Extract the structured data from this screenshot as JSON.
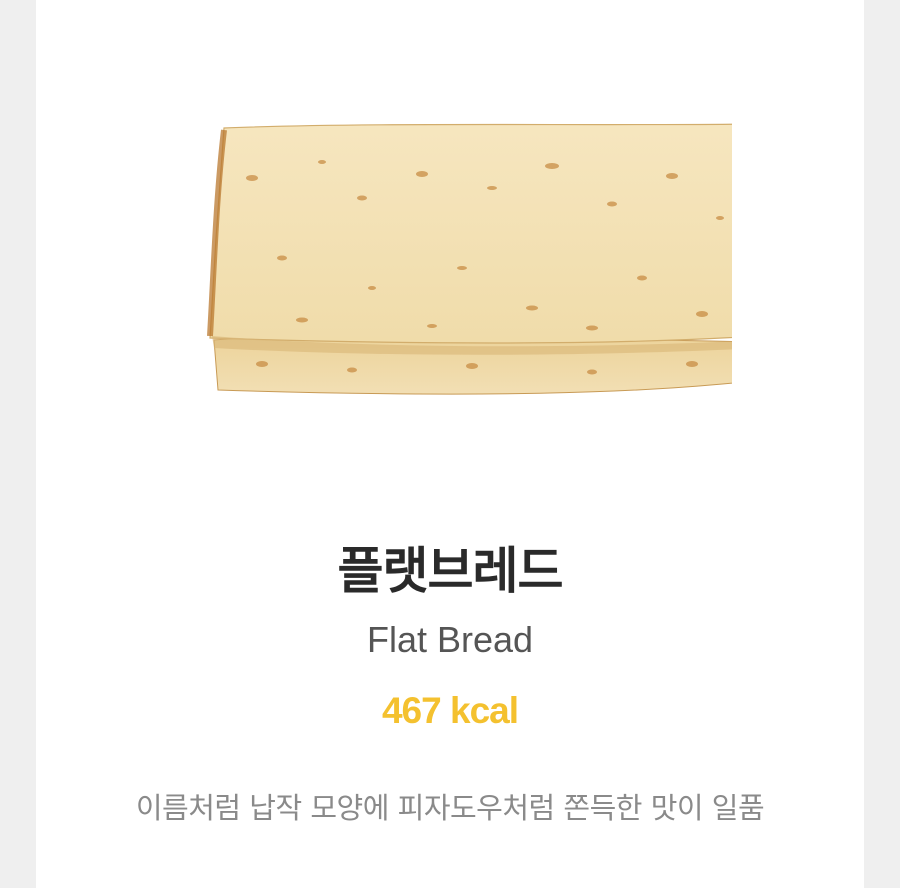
{
  "product": {
    "image_icon": "flat-bread-image",
    "name_ko": "플랫브레드",
    "name_en": "Flat Bread",
    "calories": "467 kcal",
    "description": "이름처럼 납작 모양에 피자도우처럼 쫀득한 맛이 일품"
  },
  "colors": {
    "page_background": "#efefef",
    "card_background": "#ffffff",
    "title": "#2a2a2a",
    "subtitle": "#555555",
    "calories": "#f4c12f",
    "description": "#8a8a8a"
  }
}
